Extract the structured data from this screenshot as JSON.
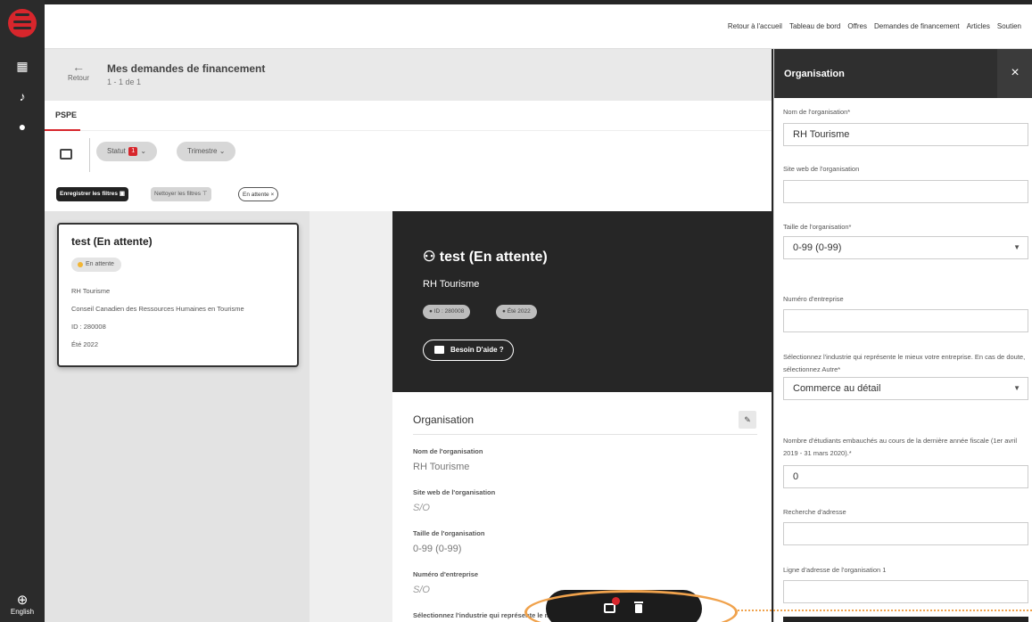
{
  "nav": {
    "links": [
      "Retour à l'accueil",
      "Tableau de bord",
      "Offres",
      "Demandes de financement",
      "Articles",
      "Soutien"
    ],
    "language": "English"
  },
  "header": {
    "back_label": "Retour",
    "title": "Mes demandes de financement",
    "subtitle": "1 - 1 de 1"
  },
  "tabs": [
    "PSPE"
  ],
  "filters": {
    "statut_label": "Statut",
    "statut_count": "1",
    "trimestre_label": "Trimestre",
    "save_label": "Enregistrer les filtres",
    "clear_label": "Nettoyer les filtres",
    "active_label": "En attente",
    "active_close": "×"
  },
  "card": {
    "title": "test (En attente)",
    "status": "En attente",
    "organization": "RH Tourisme",
    "council": "Conseil Canadien des Ressources Humaines en Tourisme",
    "id": "ID : 280008",
    "term": "Été 2022"
  },
  "detail": {
    "title": "test (En attente)",
    "organization": "RH Tourisme",
    "id_chip": "ID : 280008",
    "term_chip": "Été 2022",
    "help_label": "Besoin D'aide ?",
    "section_title": "Organisation",
    "fields": [
      {
        "label": "Nom de l'organisation",
        "value": "RH Tourisme"
      },
      {
        "label": "Site web de l'organisation",
        "value": "S/O"
      },
      {
        "label": "Taille de l'organisation",
        "value": "0-99 (0-99)"
      },
      {
        "label": "Numéro d'entreprise",
        "value": "S/O"
      },
      {
        "label": "Sélectionnez l'industrie qui représente le mieux",
        "value": ""
      }
    ]
  },
  "panel": {
    "title": "Organisation",
    "close": "×",
    "fields": [
      {
        "label": "Nom de l'organisation*",
        "value": "RH Tourisme"
      },
      {
        "label": "Site web de l'organisation",
        "value": ""
      },
      {
        "label": "Taille de l'organisation*",
        "value": "0-99 (0-99)"
      },
      {
        "label": "Numéro d'entreprise",
        "value": ""
      },
      {
        "label": "Sélectionnez l'industrie qui représente le mieux votre entreprise. En cas de doute, sélectionnez Autre*",
        "value": "Commerce au détail"
      },
      {
        "label": "Nombre d'étudiants embauchés au cours de la dernière année fiscale (1er avril 2019 - 31 mars 2020).*",
        "value": "0"
      },
      {
        "label": "Recherche d'adresse",
        "value": ""
      },
      {
        "label": "Ligne d'adresse de l'organisation 1",
        "value": ""
      }
    ]
  },
  "fab": {
    "badge": "0"
  },
  "colors": {
    "accent": "#d7262c",
    "highlight": "#f0a24c",
    "dark": "#262626"
  }
}
